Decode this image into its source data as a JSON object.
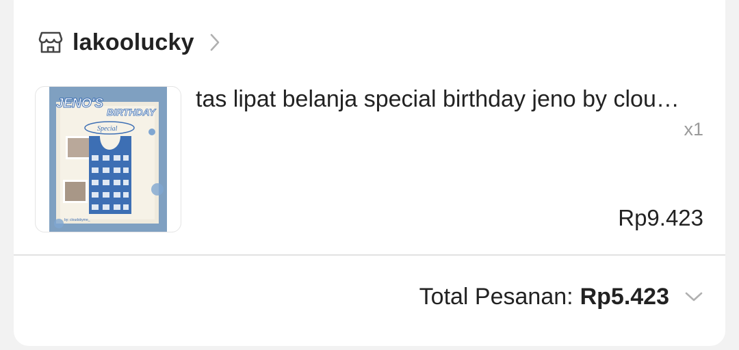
{
  "shop": {
    "name": "lakoolucky",
    "icon": "store-icon"
  },
  "product": {
    "title": "tas lipat belanja special birthday jeno by clou…",
    "quantity": "x1",
    "price": "Rp9.423",
    "image_text": {
      "headline": "JENO'S BIRTHDAY",
      "tag": "Special",
      "credit": "by: cloudsbyme_"
    }
  },
  "order": {
    "total_label": "Total Pesanan:",
    "total_value": "Rp5.423"
  },
  "colors": {
    "text": "#222222",
    "muted": "#9a9a9a",
    "divider": "#e2e2e2",
    "image_blue": "#3d6fb4"
  }
}
